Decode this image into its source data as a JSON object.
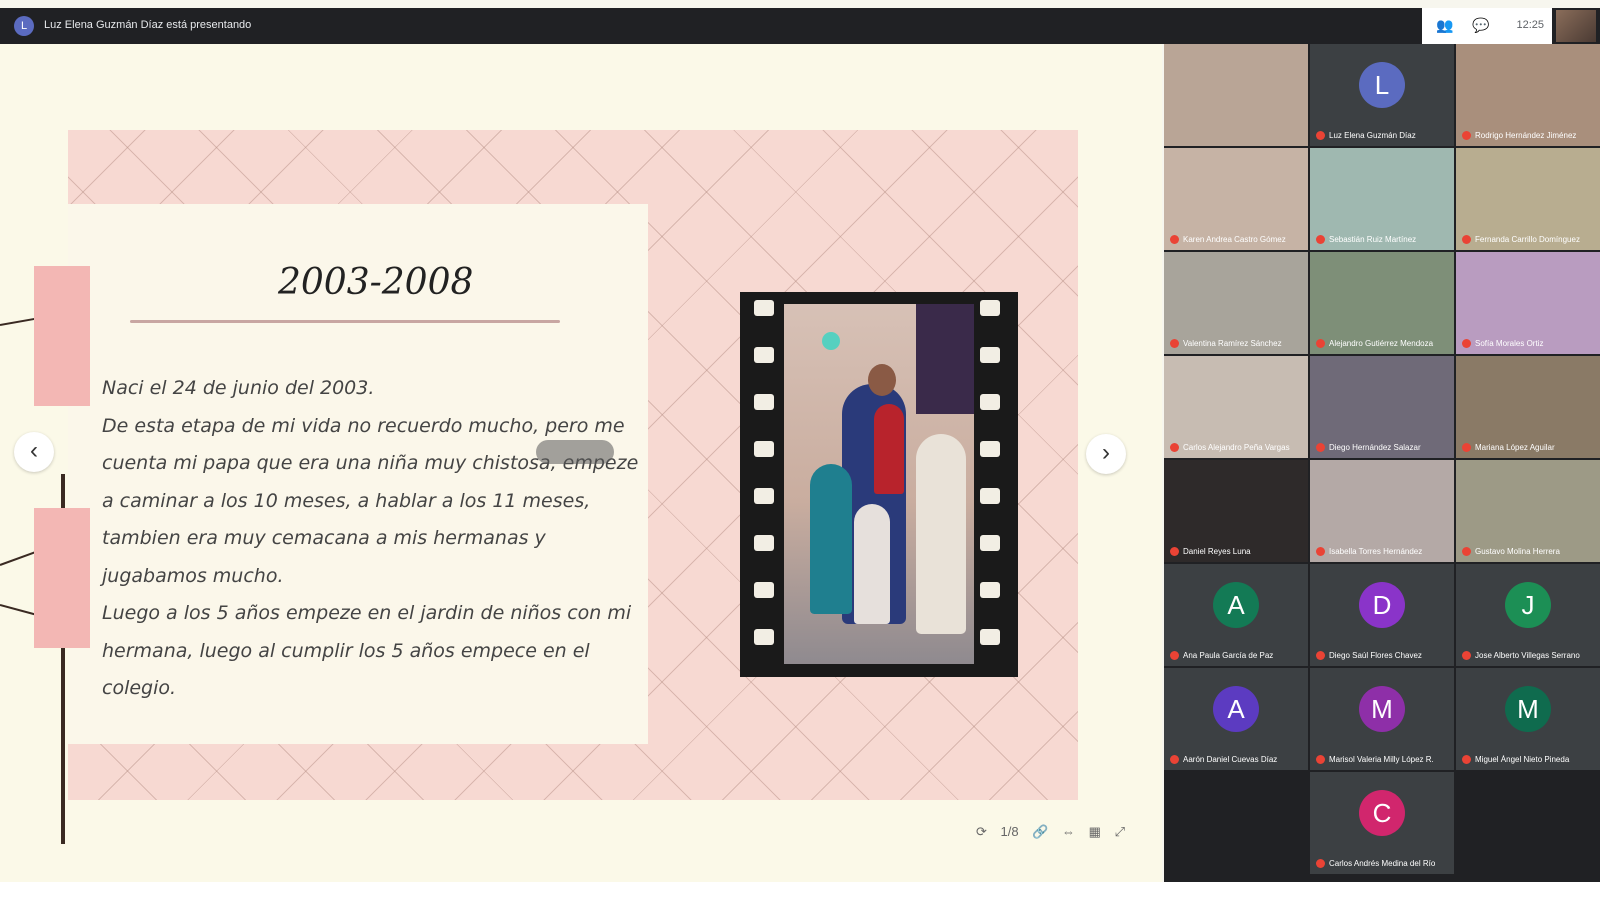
{
  "meeting": {
    "presenter_initial": "L",
    "presenter_banner": "Luz Elena Guzmán Díaz está presentando",
    "clock": "12:25"
  },
  "slide": {
    "title": "2003-2008",
    "paragraphs": [
      "Naci el 24 de junio del 2003.",
      "De esta etapa de mi vida no recuerdo mucho, pero me cuenta mi papa que era una niña muy chistosa, empeze a caminar  a los 10 meses, a hablar a los 11 meses, tambien era muy cemacana a mis hermanas y jugabamos mucho.",
      "Luego a los 5 años empeze en el jardin de niños con mi hermana, luego al cumplir los 5 años empece en el colegio."
    ],
    "page_indicator": "1/8"
  },
  "controls": {
    "prev_symbol": "‹",
    "next_symbol": "›"
  },
  "participants": [
    {
      "name": "",
      "initial": "",
      "color": "#b9a596",
      "has_video": true
    },
    {
      "name": "Luz Elena Guzmán Díaz",
      "initial": "L",
      "color": "#5b6bc0",
      "has_video": false
    },
    {
      "name": "Rodrigo Hernández Jiménez",
      "initial": "",
      "color": "#a98f7c",
      "has_video": true
    },
    {
      "name": "Karen Andrea Castro Gómez",
      "initial": "",
      "color": "#c6b3a5",
      "has_video": true
    },
    {
      "name": "Sebastián Ruiz Martínez",
      "initial": "",
      "color": "#9fb8b0",
      "has_video": true
    },
    {
      "name": "Fernanda Carrillo Domínguez",
      "initial": "",
      "color": "#b8ad90",
      "has_video": true
    },
    {
      "name": "Valentina Ramírez Sánchez",
      "initial": "",
      "color": "#a8a49b",
      "has_video": true
    },
    {
      "name": "Alejandro Gutiérrez Mendoza",
      "initial": "",
      "color": "#7e8f78",
      "has_video": true
    },
    {
      "name": "Sofía Morales Ortiz",
      "initial": "",
      "color": "#b99cc0",
      "has_video": true
    },
    {
      "name": "Carlos Alejandro Peña Vargas",
      "initial": "",
      "color": "#c7bcb2",
      "has_video": true
    },
    {
      "name": "Diego Hernández Salazar",
      "initial": "",
      "color": "#6f6a78",
      "has_video": true
    },
    {
      "name": "Mariana López Aguilar",
      "initial": "",
      "color": "#8a7a66",
      "has_video": true
    },
    {
      "name": "Daniel Reyes Luna",
      "initial": "",
      "color": "#2e2a2a",
      "has_video": true
    },
    {
      "name": "Isabella Torres Hernández",
      "initial": "",
      "color": "#b4a9a6",
      "has_video": true
    },
    {
      "name": "Gustavo Molina Herrera",
      "initial": "",
      "color": "#9d9a86",
      "has_video": true
    },
    {
      "name": "Ana Paula García de Paz",
      "initial": "A",
      "color": "#137a55",
      "has_video": false
    },
    {
      "name": "Diego Saúl Flores Chavez",
      "initial": "D",
      "color": "#8a34c9",
      "has_video": false
    },
    {
      "name": "Jose Alberto Villegas Serrano",
      "initial": "J",
      "color": "#1c8f55",
      "has_video": false
    },
    {
      "name": "Aarón Daniel Cuevas Díaz",
      "initial": "A",
      "color": "#5c3bc1",
      "has_video": false
    },
    {
      "name": "Marisol Valeria Milly López R.",
      "initial": "M",
      "color": "#8e2fa8",
      "has_video": false
    },
    {
      "name": "Miguel Ángel Nieto Pineda",
      "initial": "M",
      "color": "#0f6b4e",
      "has_video": false
    },
    {
      "name": "Carlos Andrés Medina del Río",
      "initial": "C",
      "color": "#d1266d",
      "has_video": false
    }
  ]
}
